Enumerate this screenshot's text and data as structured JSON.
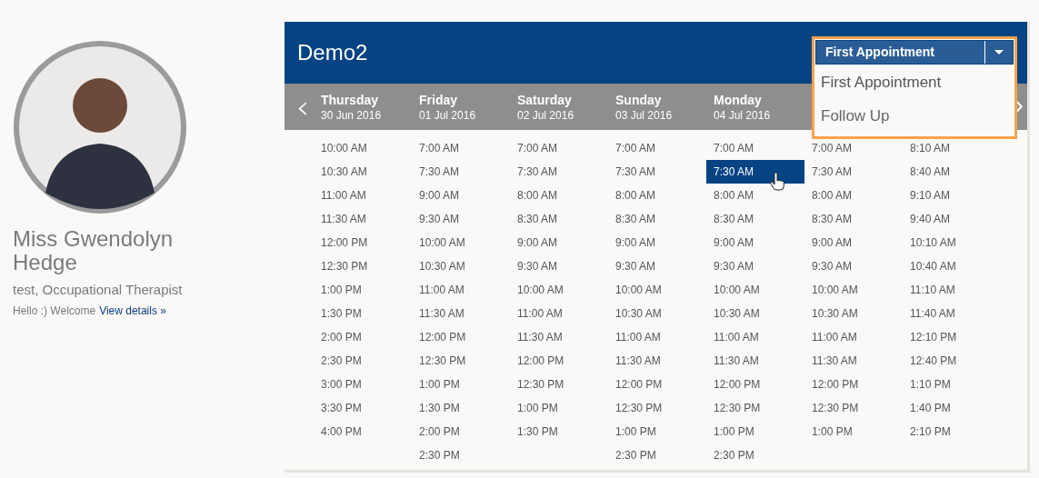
{
  "profile": {
    "name": "Miss Gwendolyn Hedge",
    "role": "test, Occupational Therapist",
    "greeting": "Hello :) Welcome",
    "link": "View details »"
  },
  "calendar": {
    "title": "Demo2",
    "appointment_type": {
      "value": "First Appointment",
      "expanded": true,
      "options": [
        {
          "label": "First Appointment",
          "selected": true
        },
        {
          "label": "Follow Up",
          "selected": false
        }
      ]
    },
    "nav": {
      "prev": "‹",
      "next": "›"
    },
    "days": [
      {
        "day": "Thursday",
        "date": "30 Jun 2016",
        "slots": [
          {
            "time": "10:00 AM",
            "selected": false
          },
          {
            "time": "10:30 AM",
            "selected": false
          },
          {
            "time": "11:00 AM",
            "selected": false
          },
          {
            "time": "11:30 AM",
            "selected": false
          },
          {
            "time": "12:00 PM",
            "selected": false
          },
          {
            "time": "12:30 PM",
            "selected": false
          },
          {
            "time": "1:00 PM",
            "selected": false
          },
          {
            "time": "1:30 PM",
            "selected": false
          },
          {
            "time": "2:00 PM",
            "selected": false
          },
          {
            "time": "2:30 PM",
            "selected": false
          },
          {
            "time": "3:00 PM",
            "selected": false
          },
          {
            "time": "3:30 PM",
            "selected": false
          },
          {
            "time": "4:00 PM",
            "selected": false
          }
        ]
      },
      {
        "day": "Friday",
        "date": "01 Jul 2016",
        "slots": [
          {
            "time": "7:00 AM",
            "selected": false
          },
          {
            "time": "7:30 AM",
            "selected": false
          },
          {
            "time": "9:00 AM",
            "selected": false
          },
          {
            "time": "9:30 AM",
            "selected": false
          },
          {
            "time": "10:00 AM",
            "selected": false
          },
          {
            "time": "10:30 AM",
            "selected": false
          },
          {
            "time": "11:00 AM",
            "selected": false
          },
          {
            "time": "11:30 AM",
            "selected": false
          },
          {
            "time": "12:00 PM",
            "selected": false
          },
          {
            "time": "12:30 PM",
            "selected": false
          },
          {
            "time": "1:00 PM",
            "selected": false
          },
          {
            "time": "1:30 PM",
            "selected": false
          },
          {
            "time": "2:00 PM",
            "selected": false
          },
          {
            "time": "2:30 PM",
            "selected": false
          }
        ]
      },
      {
        "day": "Saturday",
        "date": "02 Jul 2016",
        "slots": [
          {
            "time": "7:00 AM",
            "selected": false
          },
          {
            "time": "7:30 AM",
            "selected": false
          },
          {
            "time": "8:00 AM",
            "selected": false
          },
          {
            "time": "8:30 AM",
            "selected": false
          },
          {
            "time": "9:00 AM",
            "selected": false
          },
          {
            "time": "9:30 AM",
            "selected": false
          },
          {
            "time": "10:00 AM",
            "selected": false
          },
          {
            "time": "11:00 AM",
            "selected": false
          },
          {
            "time": "11:30 AM",
            "selected": false
          },
          {
            "time": "12:00 PM",
            "selected": false
          },
          {
            "time": "12:30 PM",
            "selected": false
          },
          {
            "time": "1:00 PM",
            "selected": false
          },
          {
            "time": "1:30 PM",
            "selected": false
          }
        ]
      },
      {
        "day": "Sunday",
        "date": "03 Jul 2016",
        "slots": [
          {
            "time": "7:00 AM",
            "selected": false
          },
          {
            "time": "7:30 AM",
            "selected": false
          },
          {
            "time": "8:00 AM",
            "selected": false
          },
          {
            "time": "8:30 AM",
            "selected": false
          },
          {
            "time": "9:00 AM",
            "selected": false
          },
          {
            "time": "9:30 AM",
            "selected": false
          },
          {
            "time": "10:00 AM",
            "selected": false
          },
          {
            "time": "10:30 AM",
            "selected": false
          },
          {
            "time": "11:00 AM",
            "selected": false
          },
          {
            "time": "11:30 AM",
            "selected": false
          },
          {
            "time": "12:00 PM",
            "selected": false
          },
          {
            "time": "12:30 PM",
            "selected": false
          },
          {
            "time": "1:00 PM",
            "selected": false
          },
          {
            "time": "2:30 PM",
            "selected": false
          }
        ]
      },
      {
        "day": "Monday",
        "date": "04 Jul 2016",
        "slots": [
          {
            "time": "7:00 AM",
            "selected": false
          },
          {
            "time": "7:30 AM",
            "selected": true
          },
          {
            "time": "8:00 AM",
            "selected": false
          },
          {
            "time": "8:30 AM",
            "selected": false
          },
          {
            "time": "9:00 AM",
            "selected": false
          },
          {
            "time": "9:30 AM",
            "selected": false
          },
          {
            "time": "10:00 AM",
            "selected": false
          },
          {
            "time": "10:30 AM",
            "selected": false
          },
          {
            "time": "11:00 AM",
            "selected": false
          },
          {
            "time": "11:30 AM",
            "selected": false
          },
          {
            "time": "12:00 PM",
            "selected": false
          },
          {
            "time": "12:30 PM",
            "selected": false
          },
          {
            "time": "1:00 PM",
            "selected": false
          },
          {
            "time": "2:30 PM",
            "selected": false
          }
        ]
      },
      {
        "slots": [
          {
            "time": "7:00 AM",
            "selected": false
          },
          {
            "time": "7:30 AM",
            "selected": false
          },
          {
            "time": "8:00 AM",
            "selected": false
          },
          {
            "time": "8:30 AM",
            "selected": false
          },
          {
            "time": "9:00 AM",
            "selected": false
          },
          {
            "time": "9:30 AM",
            "selected": false
          },
          {
            "time": "10:00 AM",
            "selected": false
          },
          {
            "time": "10:30 AM",
            "selected": false
          },
          {
            "time": "11:00 AM",
            "selected": false
          },
          {
            "time": "11:30 AM",
            "selected": false
          },
          {
            "time": "12:00 PM",
            "selected": false
          },
          {
            "time": "12:30 PM",
            "selected": false
          },
          {
            "time": "1:00 PM",
            "selected": false
          }
        ]
      },
      {
        "slots": [
          {
            "time": "8:10 AM",
            "selected": false
          },
          {
            "time": "8:40 AM",
            "selected": false
          },
          {
            "time": "9:10 AM",
            "selected": false
          },
          {
            "time": "9:40 AM",
            "selected": false
          },
          {
            "time": "10:10 AM",
            "selected": false
          },
          {
            "time": "10:40 AM",
            "selected": false
          },
          {
            "time": "11:10 AM",
            "selected": false
          },
          {
            "time": "11:40 AM",
            "selected": false
          },
          {
            "time": "12:10 PM",
            "selected": false
          },
          {
            "time": "12:40 PM",
            "selected": false
          },
          {
            "time": "1:10 PM",
            "selected": false
          },
          {
            "time": "1:40 PM",
            "selected": false
          },
          {
            "time": "2:10 PM",
            "selected": false
          }
        ]
      }
    ]
  }
}
